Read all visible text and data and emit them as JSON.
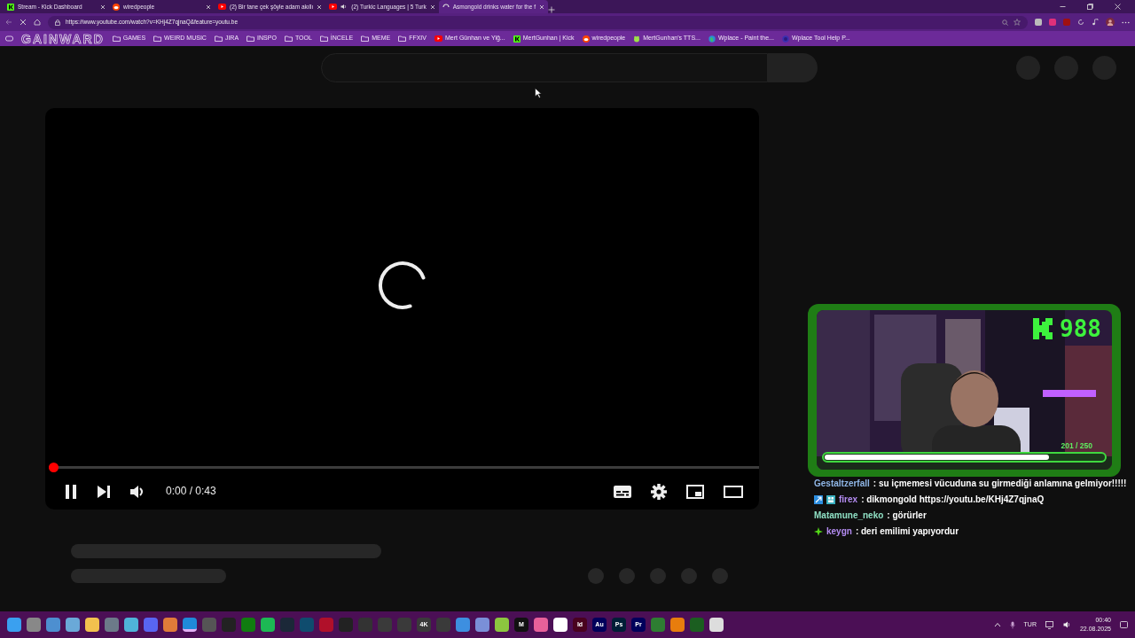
{
  "tabs": [
    {
      "title": "Stream - Kick Dashboard",
      "kind": "kick",
      "audio": false,
      "selected": false
    },
    {
      "title": "wiredpeople",
      "kind": "reddit",
      "audio": false,
      "selected": false
    },
    {
      "title": "(2) Bir tane çek şöyle adam akıllı",
      "kind": "youtube",
      "audio": false,
      "selected": false
    },
    {
      "title": "(2) Turkic Languages | 5 Turk",
      "kind": "youtube",
      "audio": true,
      "selected": false
    },
    {
      "title": "Asmongold drinks water for the f",
      "kind": "loading",
      "audio": false,
      "selected": true
    }
  ],
  "address_bar": {
    "url": "https://www.youtube.com/watch?v=KHj4Z7qjnaQ&feature=youtu.be"
  },
  "overlay_logo": "GAINWARD",
  "bookmarks": [
    {
      "label": "GAMES",
      "kind": "folder"
    },
    {
      "label": "WEIRD MUSIC",
      "kind": "folder"
    },
    {
      "label": "JIRA",
      "kind": "folder"
    },
    {
      "label": "INSPO",
      "kind": "folder"
    },
    {
      "label": "TOOL",
      "kind": "folder"
    },
    {
      "label": "İNCELE",
      "kind": "folder"
    },
    {
      "label": "MEME",
      "kind": "folder"
    },
    {
      "label": "FFXIV",
      "kind": "folder"
    },
    {
      "label": "Mert Günhan ve Yiğ...",
      "kind": "youtube"
    },
    {
      "label": "MertGunhan | Kick",
      "kind": "kick"
    },
    {
      "label": "wiredpeople",
      "kind": "reddit"
    },
    {
      "label": "MertGunhan's TTS...",
      "kind": "tts"
    },
    {
      "label": "Wplace - Paint the...",
      "kind": "globe"
    },
    {
      "label": "Wplace Tool Help P...",
      "kind": "discord"
    }
  ],
  "player": {
    "level": 0,
    "playing": true,
    "time": "0:00 / 0:43"
  },
  "stream_overlay": {
    "count": "988",
    "goal": "201  / 250",
    "level": 0.804
  },
  "chat": [
    {
      "user": "Gestaltzerfall",
      "color": "#8fb6e6",
      "kind": "plain",
      "message": ": su içmemesi vücuduna su girmediği anlamına gelmiyor!!!!!"
    },
    {
      "user": "firex",
      "color": "#b48cf2",
      "kind": "boost",
      "message": ": dikmongold https://youtu.be/KHj4Z7qjnaQ"
    },
    {
      "user": "Matamune_neko",
      "color": "#8fe0c4",
      "kind": "plain",
      "message": ": görürler"
    },
    {
      "user": "keygn",
      "color": "#b48cf2",
      "kind": "star",
      "message": ": deri emilimi yapıyordur"
    }
  ],
  "taskbar": {
    "icons": [
      {
        "color": "#3aa0f0",
        "active": false
      },
      {
        "color": "#888888",
        "active": false
      },
      {
        "color": "#4d8fd0",
        "active": false
      },
      {
        "color": "#6aa9d8",
        "active": false
      },
      {
        "color": "#f2c14e",
        "active": false
      },
      {
        "color": "#6c7a89",
        "active": false
      },
      {
        "color": "#4fb3d9",
        "active": false
      },
      {
        "color": "#5865f2",
        "active": false
      },
      {
        "color": "#e07b39",
        "active": false
      },
      {
        "color": "#1f8ad9",
        "active": true
      },
      {
        "color": "#555555",
        "active": false
      },
      {
        "color": "#222222",
        "active": false
      },
      {
        "color": "#107c10",
        "active": false
      },
      {
        "color": "#1db954",
        "active": false
      },
      {
        "color": "#1b2838",
        "active": false
      },
      {
        "color": "#0f4c6e",
        "active": false
      },
      {
        "color": "#b0102a",
        "active": false
      },
      {
        "color": "#222222",
        "active": false
      },
      {
        "color": "#333333",
        "active": false
      },
      {
        "color": "#3a3a3a",
        "active": false
      },
      {
        "color": "#3a3a3a",
        "active": false
      },
      {
        "color": "#3a3a3a",
        "label": "4K",
        "active": false
      },
      {
        "color": "#3a3a3a",
        "active": false
      },
      {
        "color": "#3d8fe0",
        "active": false
      },
      {
        "color": "#7a8fd8",
        "active": false
      },
      {
        "color": "#8cc63f",
        "active": false
      },
      {
        "color": "#111111",
        "label": "M",
        "active": false
      },
      {
        "color": "#e8609a",
        "active": false
      },
      {
        "color": "#ffffff",
        "active": false
      },
      {
        "color": "#49021f",
        "label": "Id",
        "active": false
      },
      {
        "color": "#00005b",
        "label": "Au",
        "active": false
      },
      {
        "color": "#001e36",
        "label": "Ps",
        "active": false
      },
      {
        "color": "#00005b",
        "label": "Pr",
        "active": false
      },
      {
        "color": "#2e7d32",
        "active": false
      },
      {
        "color": "#e87d0d",
        "active": false
      },
      {
        "color": "#1b5e20",
        "active": false
      },
      {
        "color": "#dddddd",
        "active": false
      }
    ],
    "language": "TUR",
    "time": "00:40",
    "date": "22.08.2025"
  }
}
